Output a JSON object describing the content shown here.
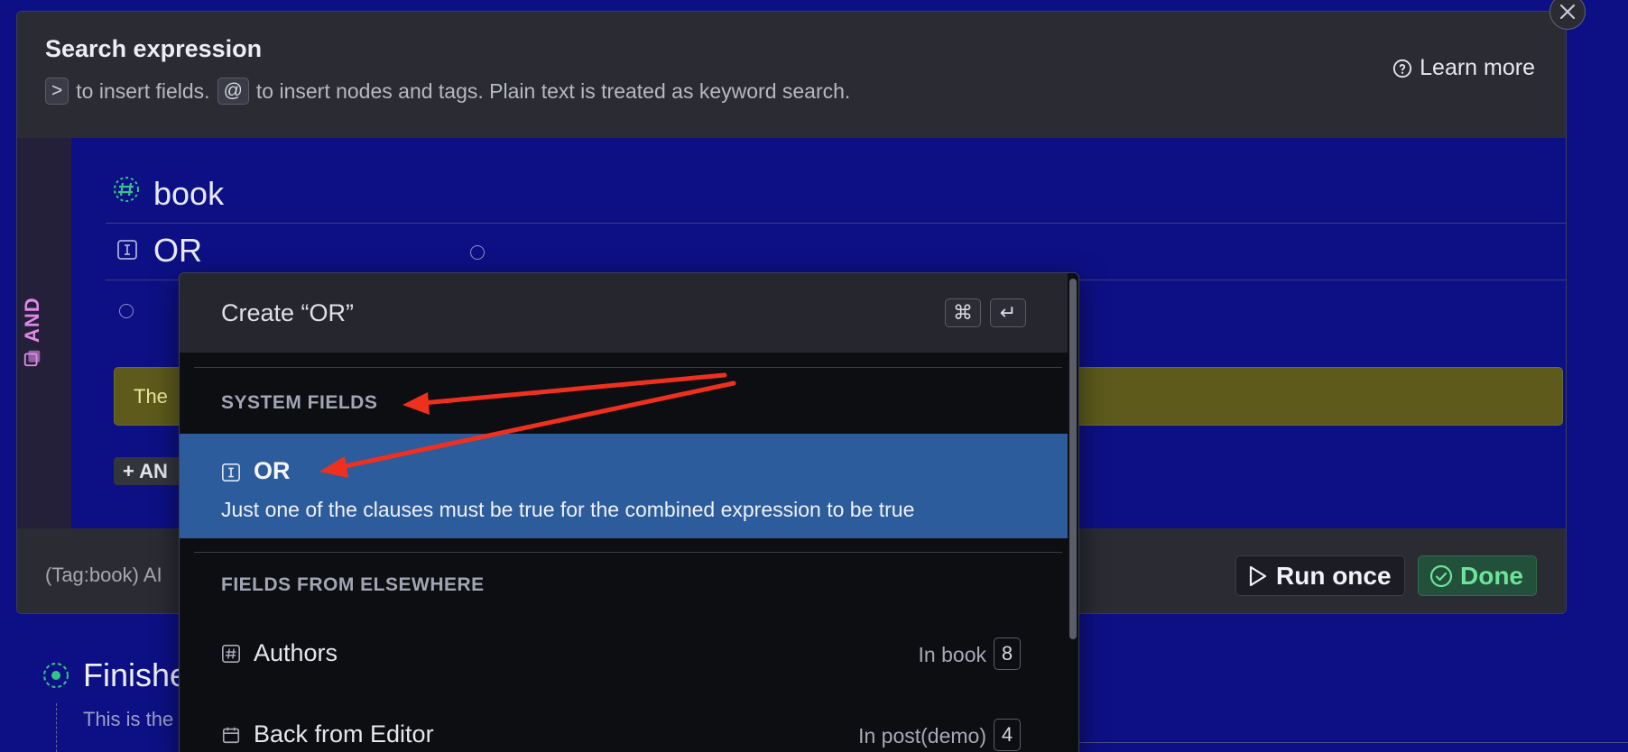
{
  "header": {
    "title": "Search expression",
    "hint_key1": ">",
    "hint_text1": "to insert fields.",
    "hint_key2": "@",
    "hint_text2": "to insert nodes and tags. Plain text is treated as keyword search.",
    "learn_more": "Learn more"
  },
  "expression": {
    "operator": "AND",
    "rows": [
      {
        "icon": "tag-hash-icon",
        "text": "book"
      },
      {
        "icon": "field-icon",
        "text": "OR"
      }
    ],
    "warning_text": "The",
    "add_button": "+ AN"
  },
  "footer": {
    "query_text": "(Tag:book) AI",
    "run_label": "Run once",
    "done_label": "Done"
  },
  "popup": {
    "create_label": "Create “OR”",
    "shortcut_cmd": "⌘",
    "shortcut_enter": "↵",
    "section_system": "SYSTEM FIELDS",
    "selected_item": {
      "title": "OR",
      "description": "Just one of the clauses must be true for the combined expression to be true"
    },
    "section_elsewhere": "FIELDS FROM ELSEWHERE",
    "items": [
      {
        "title": "Authors",
        "meta": "In book",
        "count": "8",
        "icon": "hash-field-icon"
      },
      {
        "title": "Back from Editor",
        "meta": "In post(demo)",
        "count": "4",
        "icon": "calendar-icon"
      }
    ]
  },
  "background_node": {
    "title": "Finishe",
    "subtitle": "This is the"
  },
  "colors": {
    "background": "#0d1084",
    "selected": "#2c5c9c",
    "annotation_arrow": "#f0301e",
    "done_green": "#6ee39b",
    "and_purple": "#dc8ae8"
  }
}
